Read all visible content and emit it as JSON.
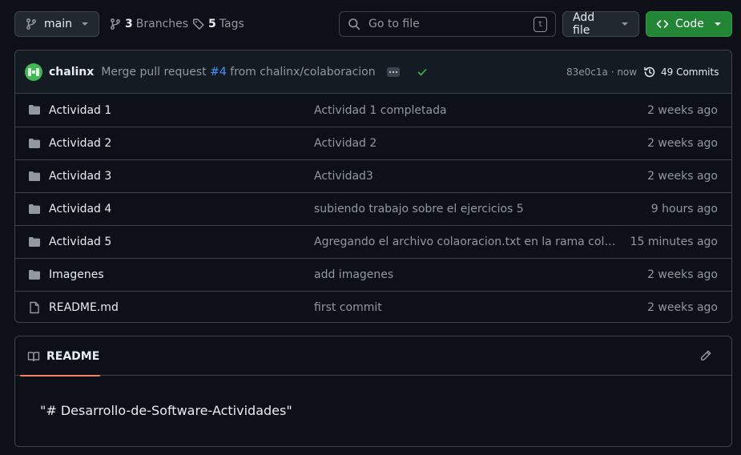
{
  "toolbar": {
    "branch": "main",
    "branches_count": "3",
    "branches_label": "Branches",
    "tags_count": "5",
    "tags_label": "Tags",
    "search_placeholder": "Go to file",
    "search_shortcut": "t",
    "add_file_label": "Add file",
    "code_label": "Code"
  },
  "commit": {
    "author": "chalinx",
    "message_prefix": "Merge pull request",
    "pr_link": "#4",
    "message_suffix": "from chalinx/colaboracion",
    "sha_time": "83e0c1a · now",
    "commits_label": "49 Commits",
    "status_color": "#3fb950"
  },
  "files": [
    {
      "type": "folder",
      "name": "Actividad 1",
      "message": "Actividad 1 completada",
      "age": "2 weeks ago"
    },
    {
      "type": "folder",
      "name": "Actividad 2",
      "message": "Actividad 2",
      "age": "2 weeks ago"
    },
    {
      "type": "folder",
      "name": "Actividad 3",
      "message": "Actividad3",
      "age": "2 weeks ago"
    },
    {
      "type": "folder",
      "name": "Actividad 4",
      "message": "subiendo trabajo sobre el ejercicios 5",
      "age": "9 hours ago"
    },
    {
      "type": "folder",
      "name": "Actividad 5",
      "message": "Agregando el archivo colaoracion.txt en la rama colabor…",
      "age": "15 minutes ago"
    },
    {
      "type": "folder",
      "name": "Imagenes",
      "message": "add imagenes",
      "age": "2 weeks ago"
    },
    {
      "type": "file",
      "name": "README.md",
      "message": "first commit",
      "age": "2 weeks ago"
    }
  ],
  "readme": {
    "tab_label": "README",
    "content": "\"# Desarrollo-de-Software-Actividades\""
  },
  "colors": {
    "background": "#0d1117",
    "code_button": "#238636",
    "link": "#4493f8",
    "tab_underline": "#f78166"
  }
}
